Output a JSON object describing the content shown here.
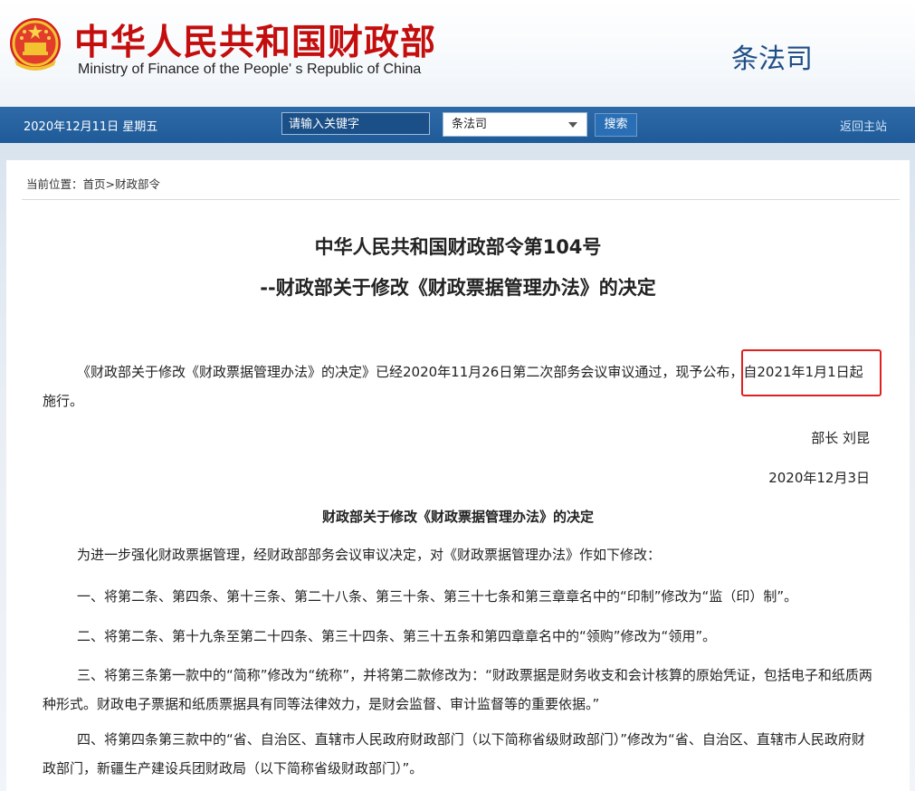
{
  "header": {
    "cn_title": "中华人民共和国财政部",
    "en_title": "Ministry of Finance of the People' s Republic of China",
    "dept_name": "条法司"
  },
  "navbar": {
    "date": "2020年12月11日  星期五",
    "search_placeholder": "请输入关键字",
    "select_value": "条法司",
    "search_button": "搜索",
    "home_link": "返回主站"
  },
  "breadcrumb": {
    "prefix": "当前位置：",
    "home": "首页",
    "sep": ">",
    "section": "财政部令"
  },
  "document": {
    "title_line1": "中华人民共和国财政部令第104号",
    "title_line2": "--财政部关于修改《财政票据管理办法》的决定",
    "intro": "《财政部关于修改《财政票据管理办法》的决定》已经2020年11月26日第二次部务会议审议通过，现予公布，自2021年1月1日起施行。",
    "signer": "部长  刘昆",
    "date": "2020年12月3日",
    "sub_title": "财政部关于修改《财政票据管理办法》的决定",
    "p1": "为进一步强化财政票据管理，经财政部部务会议审议决定，对《财政票据管理办法》作如下修改：",
    "p2": "一、将第二条、第四条、第十三条、第二十八条、第三十条、第三十七条和第三章章名中的“印制”修改为“监（印）制”。",
    "p3": "二、将第二条、第十九条至第二十四条、第三十四条、第三十五条和第四章章名中的“领购”修改为“领用”。",
    "p4": "三、将第三条第一款中的“简称”修改为“统称”，并将第二款修改为：“财政票据是财务收支和会计核算的原始凭证，包括电子和纸质两种形式。财政电子票据和纸质票据具有同等法律效力，是财会监督、审计监督等的重要依据。”",
    "p5": "四、将第四条第三款中的“省、自治区、直辖市人民政府财政部门（以下简称省级财政部门）”修改为“省、自治区、直辖市人民政府财政部门，新疆生产建设兵团财政局（以下简称省级财政部门）”。"
  },
  "colors": {
    "brand_red": "#c40d0d",
    "nav_blue": "#1f5b98",
    "highlight": "#e02020"
  }
}
